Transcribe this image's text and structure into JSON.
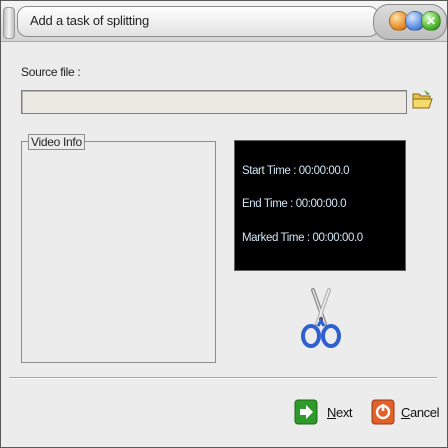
{
  "window": {
    "title": "Add a task of splitting",
    "controls": [
      "minimize",
      "maximize",
      "close"
    ]
  },
  "source": {
    "label": "Source file :",
    "value": ""
  },
  "video_info": {
    "title": "Video Info"
  },
  "times": {
    "start": "Start Time  : 00:00:00.0",
    "end": "End Time    : 00:00:00.0",
    "marked": "Marked Time : 00:00:00.0"
  },
  "buttons": {
    "next": "Next",
    "cancel": "Cancel"
  },
  "icons": {
    "folder": "folder-open-icon",
    "scissors": "scissors-icon",
    "next": "next-arrow-icon",
    "cancel": "cancel-icon"
  },
  "colors": {
    "panel_bg": "#000000",
    "time_text": "#cfe6f5",
    "next_green": "#2e9a2a",
    "cancel_orange": "#e2602a"
  }
}
